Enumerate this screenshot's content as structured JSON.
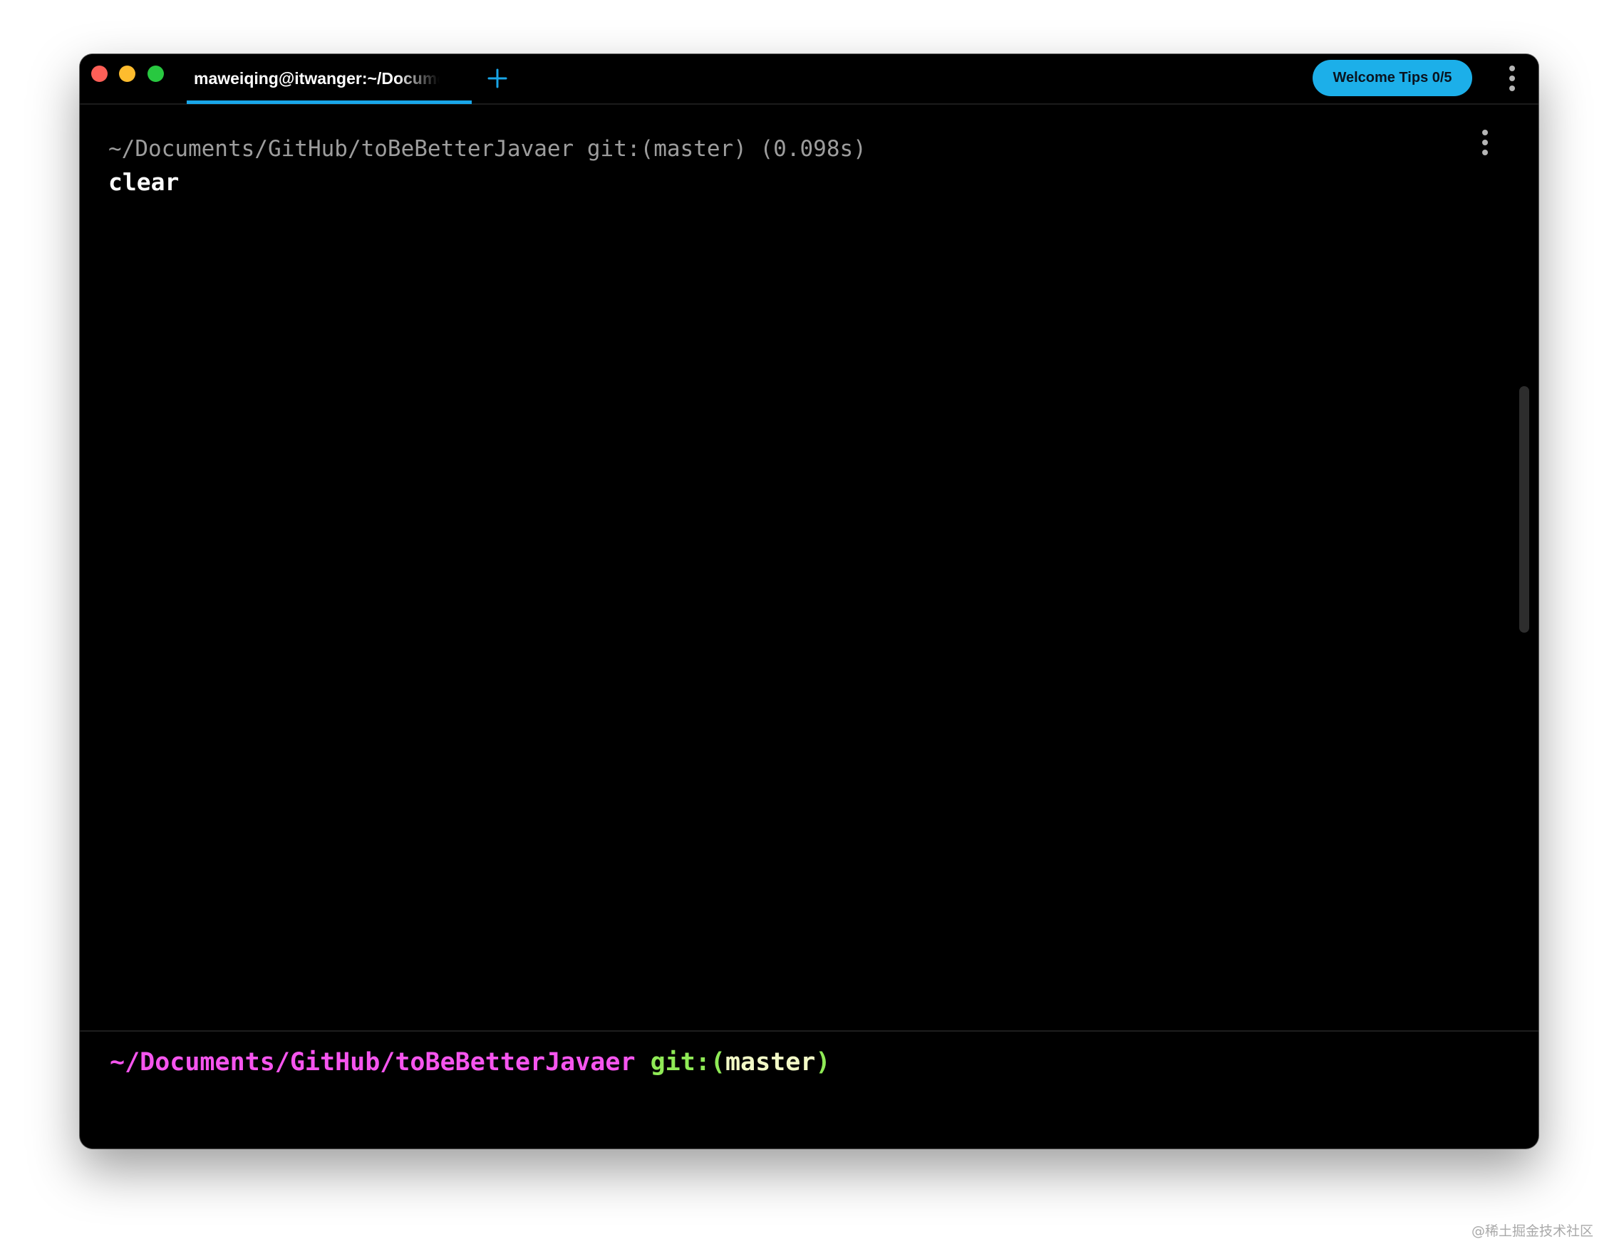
{
  "tab": {
    "title": "maweiqing@itwanger:~/Documents/GitHub/toBeBetterJavaer",
    "accent_color": "#19a6e8"
  },
  "titlebar": {
    "new_tab_icon": "plus-icon",
    "welcome_button_label": "Welcome Tips 0/5",
    "welcome_button_color": "#1cafe9",
    "menu_icon": "vertical-ellipsis-icon"
  },
  "window_controls": {
    "close_color": "#fe5f57",
    "minimize_color": "#febc2e",
    "zoom_color": "#28c840"
  },
  "block": {
    "header": "~/Documents/GitHub/toBeBetterJavaer git:(master) (0.098s)",
    "command": "clear",
    "menu_icon": "vertical-ellipsis-icon"
  },
  "prompt": {
    "path": "~/Documents/GitHub/toBeBetterJavaer",
    "git_prefix": "git:(",
    "branch": "master",
    "git_suffix": ")",
    "colors": {
      "path": "#f555ee",
      "git": "#8fea56",
      "branch": "#f2f9c6"
    }
  },
  "watermark": "@稀土掘金技术社区"
}
